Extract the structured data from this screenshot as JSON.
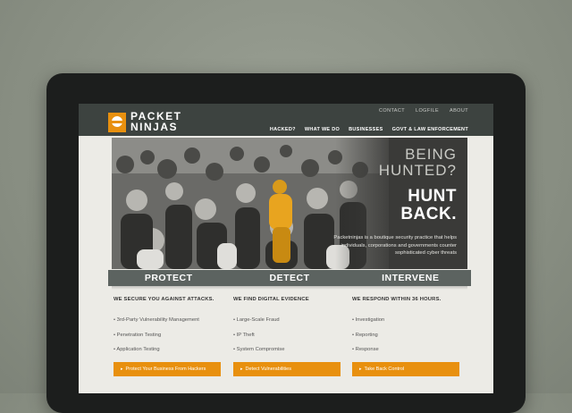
{
  "brand": {
    "line1": "PACKET",
    "line2": "NINJAS"
  },
  "top_links": [
    "CONTACT",
    "LOGFILE",
    "ABOUT"
  ],
  "main_nav": [
    "HACKED?",
    "WHAT WE DO",
    "BUSINESSES",
    "GOVT & LAW ENFORCEMENT"
  ],
  "hero": {
    "headline1": "BEING",
    "headline2": "HUNTED?",
    "headline3": "HUNT",
    "headline4": "BACK.",
    "description": "Packetninjas is a boutique security practice that helps individuals, corporations and governments counter sophisticated cyber threats"
  },
  "banner": [
    "PROTECT",
    "DETECT",
    "INTERVENE"
  ],
  "columns": [
    {
      "heading": "WE SECURE YOU AGAINST ATTACKS.",
      "items": [
        "3rd-Party Vulnerability Management",
        "Penetration Testing",
        "Application Testing"
      ],
      "cta": "Protect Your Business From Hackers"
    },
    {
      "heading": "WE FIND DIGITAL EVIDENCE",
      "items": [
        "Large-Scale Fraud",
        "IP Theft",
        "System Compromise"
      ],
      "cta": "Detect Vulnerabilities"
    },
    {
      "heading": "WE RESPOND WITHIN 36 HOURS.",
      "items": [
        "Investigation",
        "Reporting",
        "Response"
      ],
      "cta": "Take Back Control"
    }
  ],
  "colors": {
    "accent": "#e8900f",
    "header": "#3d4340",
    "banner": "#5c6360"
  }
}
